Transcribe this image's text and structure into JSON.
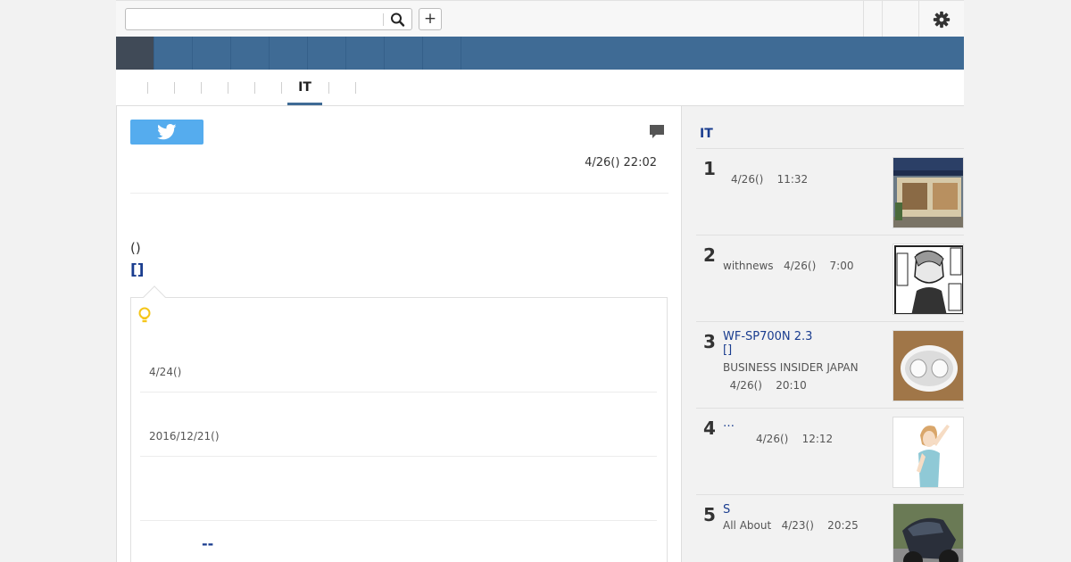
{
  "search": {
    "placeholder": "",
    "value": ""
  },
  "toolbar": {
    "add_label": "+"
  },
  "subtabs": {
    "active_label": "IT"
  },
  "article": {
    "date": "4/26() 22:02",
    "paren_text": "()",
    "title_link": "[]",
    "related": [
      {
        "date": "4/24()"
      },
      {
        "date": "2016/12/21()"
      },
      {
        "date": ""
      }
    ],
    "related_more": "--"
  },
  "sidebar": {
    "title": "IT",
    "ranking": [
      {
        "rank": "1",
        "title": "",
        "meta": "4/26()    11:32",
        "thumb": "shop-storefront"
      },
      {
        "rank": "2",
        "title": "",
        "meta": "withnews   4/26()    7:00",
        "thumb": "manga-panel"
      },
      {
        "rank": "3",
        "title": "WF-SP700N 2.3\n[]",
        "meta": "BUSINESS INSIDER JAPAN\n  4/26()    20:10",
        "thumb": "wireless-earbuds"
      },
      {
        "rank": "4",
        "title": "…",
        "meta": "4/26()    12:12",
        "thumb": "woman-illustration"
      },
      {
        "rank": "5",
        "title": "S",
        "meta": "All About   4/23()    20:25",
        "thumb": "motorcycle"
      }
    ]
  },
  "colors": {
    "nav_bar": "#3f6b95",
    "nav_active": "#404a57",
    "link": "#1a3d8f",
    "twitter": "#55acee",
    "bulb": "#f5c518"
  }
}
